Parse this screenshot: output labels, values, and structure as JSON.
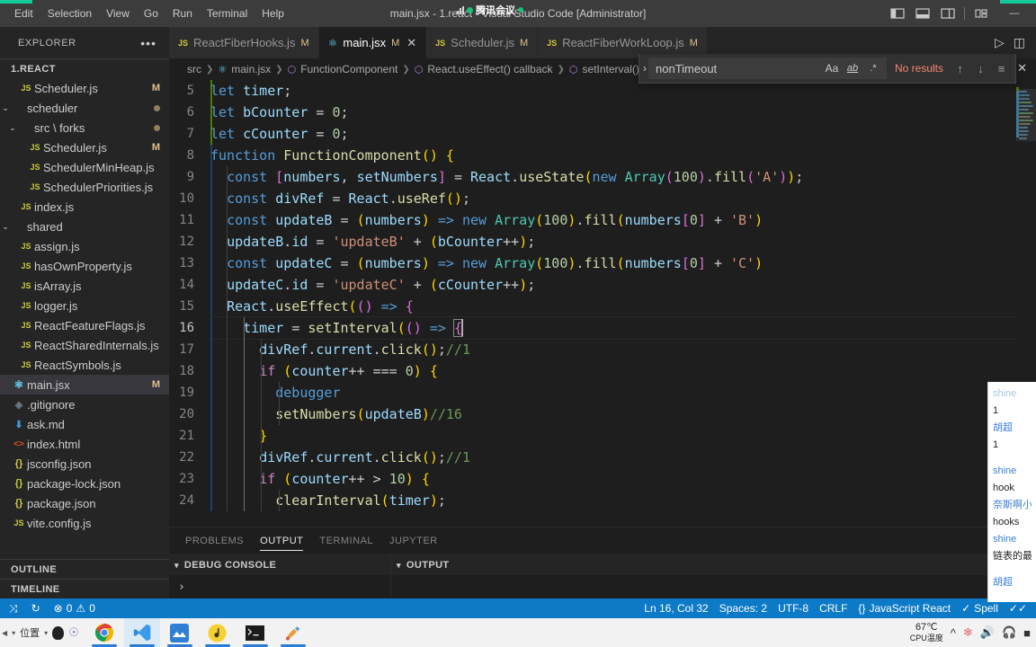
{
  "window": {
    "title": "main.jsx - 1.react - Visual Studio Code [Administrator]",
    "meeting_label": "腾讯会议",
    "minimize": "—"
  },
  "menu": [
    "Edit",
    "Selection",
    "View",
    "Go",
    "Run",
    "Terminal",
    "Help"
  ],
  "sidebar": {
    "header": "EXPLORER",
    "more_icon": "•••",
    "root": "1.REACT",
    "items": [
      {
        "label": "Scheduler.js",
        "icon": "js-file-icon",
        "indent": 1,
        "badge": "M",
        "chevron": ""
      },
      {
        "label": "scheduler",
        "icon": "folder-icon",
        "indent": 0,
        "dot": true,
        "chevron": "⌄"
      },
      {
        "label": "src \\ forks",
        "icon": "folder-icon",
        "indent": 1,
        "dot": true,
        "chevron": "⌄"
      },
      {
        "label": "Scheduler.js",
        "icon": "js-file-icon",
        "indent": 2,
        "badge": "M",
        "chevron": ""
      },
      {
        "label": "SchedulerMinHeap.js",
        "icon": "js-file-icon",
        "indent": 2,
        "chevron": ""
      },
      {
        "label": "SchedulerPriorities.js",
        "icon": "js-file-icon",
        "indent": 2,
        "chevron": ""
      },
      {
        "label": "index.js",
        "icon": "js-file-icon",
        "indent": 1,
        "chevron": ""
      },
      {
        "label": "shared",
        "icon": "folder-icon",
        "indent": 0,
        "chevron": "⌄"
      },
      {
        "label": "assign.js",
        "icon": "js-file-icon",
        "indent": 1,
        "chevron": ""
      },
      {
        "label": "hasOwnProperty.js",
        "icon": "js-file-icon",
        "indent": 1,
        "chevron": ""
      },
      {
        "label": "isArray.js",
        "icon": "js-file-icon",
        "indent": 1,
        "chevron": ""
      },
      {
        "label": "logger.js",
        "icon": "js-file-icon",
        "indent": 1,
        "chevron": ""
      },
      {
        "label": "ReactFeatureFlags.js",
        "icon": "js-file-icon",
        "indent": 1,
        "chevron": ""
      },
      {
        "label": "ReactSharedInternals.js",
        "icon": "js-file-icon",
        "indent": 1,
        "chevron": ""
      },
      {
        "label": "ReactSymbols.js",
        "icon": "js-file-icon",
        "indent": 1,
        "chevron": ""
      },
      {
        "label": "main.jsx",
        "icon": "react-file-icon",
        "indent": 0,
        "badge": "M",
        "selected": true,
        "chevron": ""
      },
      {
        "label": ".gitignore",
        "icon": "git-file-icon",
        "indent": 0,
        "chevron": ""
      },
      {
        "label": "ask.md",
        "icon": "markdown-file-icon",
        "indent": 0,
        "chevron": ""
      },
      {
        "label": "index.html",
        "icon": "html-file-icon",
        "indent": 0,
        "chevron": ""
      },
      {
        "label": "jsconfig.json",
        "icon": "json-file-icon",
        "indent": 0,
        "chevron": ""
      },
      {
        "label": "package-lock.json",
        "icon": "json-file-icon",
        "indent": 0,
        "chevron": ""
      },
      {
        "label": "package.json",
        "icon": "json-file-icon",
        "indent": 0,
        "chevron": ""
      },
      {
        "label": "vite.config.js",
        "icon": "js-file-icon",
        "indent": 0,
        "chevron": ""
      }
    ],
    "outline": "OUTLINE",
    "timeline": "TIMELINE"
  },
  "tabs": [
    {
      "label": "ReactFiberHooks.js",
      "badge": "M",
      "icon": "js",
      "active": false,
      "closable": false
    },
    {
      "label": "main.jsx",
      "badge": "M",
      "icon": "react",
      "active": true,
      "closable": true
    },
    {
      "label": "Scheduler.js",
      "badge": "M",
      "icon": "js",
      "active": false,
      "closable": false
    },
    {
      "label": "ReactFiberWorkLoop.js",
      "badge": "M",
      "icon": "js",
      "active": false,
      "closable": false
    }
  ],
  "breadcrumb": [
    {
      "label": "src",
      "icon": ""
    },
    {
      "label": "main.jsx",
      "icon": "react"
    },
    {
      "label": "FunctionComponent",
      "icon": "sym"
    },
    {
      "label": "React.useEffect() callback",
      "icon": "sym"
    },
    {
      "label": "setInterval() callback",
      "icon": "sym"
    }
  ],
  "find": {
    "query": "nonTimeout",
    "result_text": "No results",
    "match_case": "Aa",
    "whole_word": "ab",
    "regex": ".*",
    "prev": "↑",
    "next": "↓",
    "find_in_selection": "≡",
    "close": "✕",
    "expand": "›"
  },
  "code": {
    "first_line": 5,
    "lines": [
      {
        "n": 5,
        "indent": 0
      },
      {
        "n": 6,
        "indent": 0
      },
      {
        "n": 7,
        "indent": 0
      },
      {
        "n": 8,
        "indent": 0
      },
      {
        "n": 9,
        "indent": 1
      },
      {
        "n": 10,
        "indent": 1
      },
      {
        "n": 11,
        "indent": 1
      },
      {
        "n": 12,
        "indent": 1
      },
      {
        "n": 13,
        "indent": 1
      },
      {
        "n": 14,
        "indent": 1
      },
      {
        "n": 15,
        "indent": 1
      },
      {
        "n": 16,
        "indent": 2,
        "current": true
      },
      {
        "n": 17,
        "indent": 3
      },
      {
        "n": 18,
        "indent": 3
      },
      {
        "n": 19,
        "indent": 4
      },
      {
        "n": 20,
        "indent": 4
      },
      {
        "n": 21,
        "indent": 3
      },
      {
        "n": 22,
        "indent": 3
      },
      {
        "n": 23,
        "indent": 3
      },
      {
        "n": 24,
        "indent": 4
      }
    ],
    "text": {
      "l5": "let timer;",
      "l6": "let bCounter = 0;",
      "l7": "let cCounter = 0;",
      "l8": "function FunctionComponent() {",
      "l9": "  const [numbers, setNumbers] = React.useState(new Array(100).fill('A'));",
      "l10": "  const divRef = React.useRef();",
      "l11": "  const updateB = (numbers) => new Array(100).fill(numbers[0] + 'B')",
      "l12": "  updateB.id = 'updateB' + (bCounter++);",
      "l13": "  const updateC = (numbers) => new Array(100).fill(numbers[0] + 'C')",
      "l14": "  updateC.id = 'updateC' + (cCounter++);",
      "l15": "  React.useEffect(() => {",
      "l16": "    timer = setInterval(() => {",
      "l17": "      divRef.current.click();//1",
      "l18": "      if (counter++ === 0) {",
      "l19": "        debugger",
      "l20": "        setNumbers(updateB)//16",
      "l21": "      }",
      "l22": "      divRef.current.click();//1",
      "l23": "      if (counter++ > 10) {",
      "l24": "        clearInterval(timer);"
    }
  },
  "panel": {
    "tabs": [
      "PROBLEMS",
      "OUTPUT",
      "TERMINAL",
      "JUPYTER"
    ],
    "active_tab": "OUTPUT",
    "sections": [
      {
        "title": "DEBUG CONSOLE",
        "prompt": "›"
      },
      {
        "title": "OUTPUT",
        "prompt": ""
      }
    ]
  },
  "statusbar": {
    "remote_icon": "⤨",
    "sync_icon": "↻",
    "errors": "0",
    "warnings": "0",
    "error_icon": "⊗",
    "warning_icon": "⚠",
    "right": [
      {
        "label": "Ln 16, Col 32",
        "name": "cursor-position"
      },
      {
        "label": "Spaces: 2",
        "name": "indentation"
      },
      {
        "label": "UTF-8",
        "name": "encoding"
      },
      {
        "label": "CRLF",
        "name": "eol"
      },
      {
        "label": "JavaScript React",
        "name": "language-mode",
        "icon": "{}"
      },
      {
        "label": "Spell",
        "name": "spell-checker",
        "icon": "✓"
      },
      {
        "label": "",
        "name": "notifications",
        "icon": "✓✓"
      }
    ]
  },
  "chat": {
    "messages": [
      {
        "text": "shine",
        "type": "name",
        "faded": true
      },
      {
        "text": "1",
        "type": "msg"
      },
      {
        "text": "胡超",
        "type": "name"
      },
      {
        "text": "1",
        "type": "msg"
      },
      {
        "text": "",
        "type": "blank"
      },
      {
        "text": "shine",
        "type": "name"
      },
      {
        "text": "hook",
        "type": "msg"
      },
      {
        "text": "奈斯啊小",
        "type": "name"
      },
      {
        "text": "hooks",
        "type": "msg"
      },
      {
        "text": "shine",
        "type": "name"
      },
      {
        "text": "链表的最",
        "type": "msg"
      },
      {
        "text": "",
        "type": "blank"
      },
      {
        "text": "胡超",
        "type": "name"
      }
    ]
  },
  "taskbar": {
    "location_label": "位置",
    "temp": "67℃",
    "temp_label": "CPU温度",
    "tray": [
      "∧",
      "♻",
      "ὐA",
      "ὐC"
    ]
  }
}
